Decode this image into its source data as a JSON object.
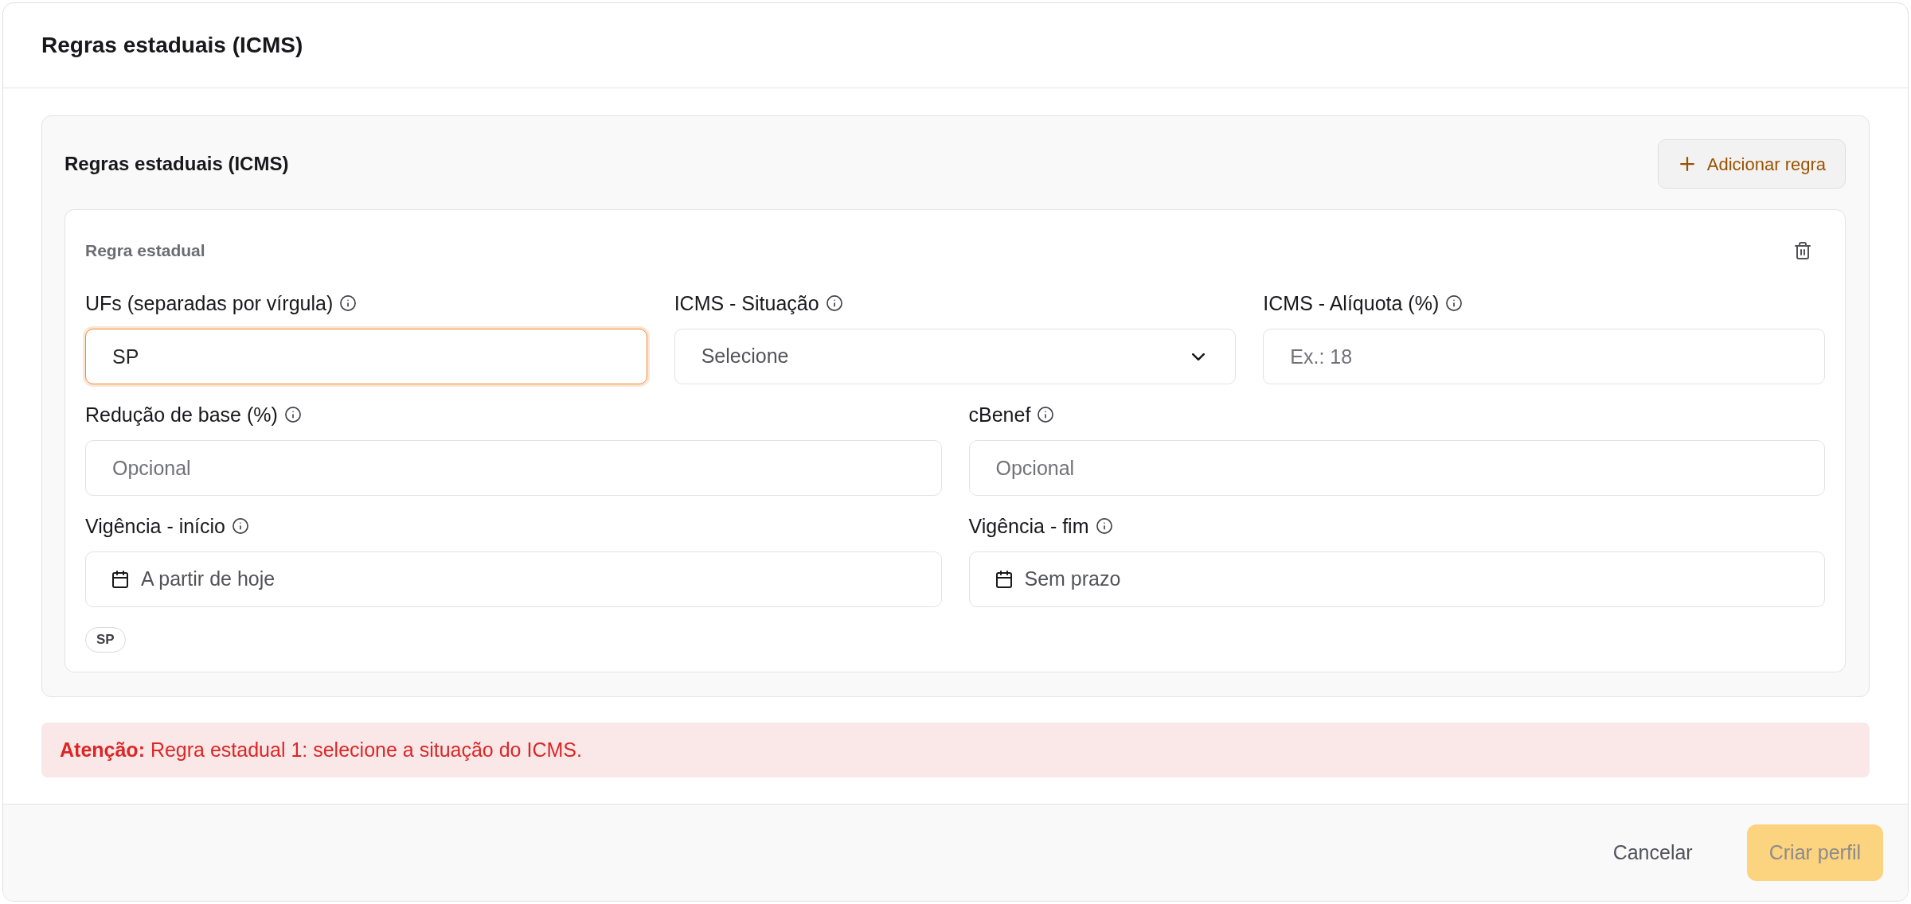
{
  "dialog": {
    "title": "Regras estaduais (ICMS)"
  },
  "section": {
    "title": "Regras estaduais (ICMS)",
    "add_button": {
      "label": "Adicionar regra"
    },
    "rules": [
      {
        "title": "Regra estadual",
        "rows": [
          [
            {
              "label": "UFs (separadas por vírgula)",
              "kind": "text",
              "value": "SP",
              "focused": true
            },
            {
              "label": "ICMS - Situação",
              "kind": "select",
              "placeholder": "Selecione",
              "focused": false
            },
            {
              "label": "ICMS - Alíquota (%)",
              "kind": "text",
              "placeholder": "Ex.: 18",
              "focused": false
            }
          ],
          [
            {
              "label": "Redução de base (%)",
              "kind": "text",
              "placeholder": "Opcional",
              "focused": false
            },
            {
              "label": "cBenef",
              "kind": "text",
              "placeholder": "Opcional",
              "focused": false
            }
          ],
          [
            {
              "label": "Vigência - início",
              "kind": "date",
              "placeholder": "A partir de hoje",
              "focused": false
            },
            {
              "label": "Vigência - fim",
              "kind": "date",
              "placeholder": "Sem prazo",
              "focused": false
            }
          ]
        ],
        "tags": [
          "SP"
        ]
      }
    ]
  },
  "alert": {
    "message": "**Atenção:** Regra estadual 1: selecione a situação do ICMS."
  },
  "footer": {
    "buttons": [
      {
        "label": "Cancelar",
        "kind": "ghost",
        "disabled": false
      },
      {
        "label": "Criar perfil",
        "kind": "primary",
        "disabled": true
      }
    ]
  }
}
